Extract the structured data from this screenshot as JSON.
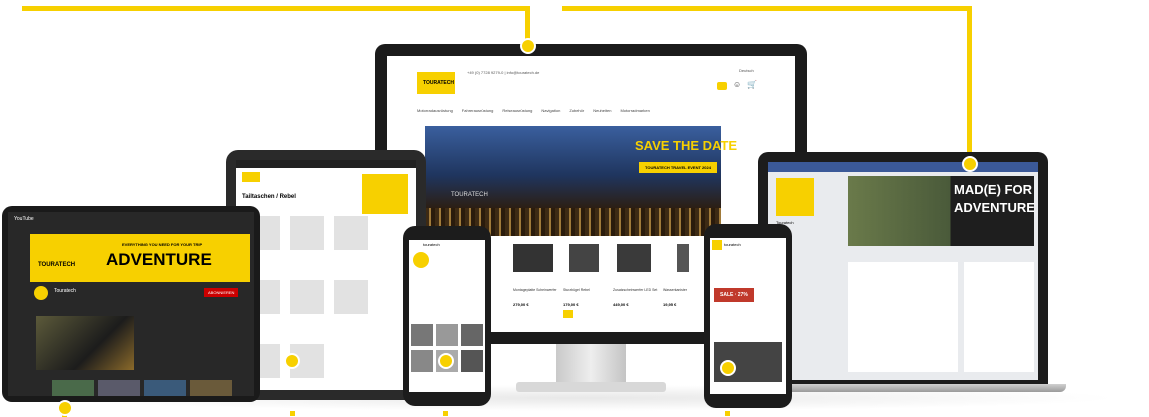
{
  "brand": {
    "name": "TOURATECH",
    "accent": "#f7d000",
    "dark": "#1e1e1e"
  },
  "youtube": {
    "logo": "YouTube",
    "banner_tag": "EVERYTHING YOU NEED FOR YOUR TRIP",
    "banner_brand": "TOURATECH",
    "banner_word": "ADVENTURE",
    "channel": "Touratech",
    "subscribe": "ABONNIEREN"
  },
  "tablet": {
    "heading": "Tailtaschen / Rebel"
  },
  "desktop": {
    "phone": "+49 (0) 7728 9279-0 | info@touratech.de",
    "lang": "Deutsch",
    "nav": [
      "Motorradausrüstung",
      "Fahrerausrüstung",
      "Reiseausrüstung",
      "Navigation",
      "Zubehör",
      "Neuheiten",
      "Motorradmarken"
    ],
    "hero_title": "SAVE THE DATE",
    "hero_button": "TOURATECH TRAVEL EVENT 2024",
    "hero_logo": "TOURATECH",
    "products": [
      {
        "name": "Montageplatte Scheinwerfer",
        "price": "279,00 €"
      },
      {
        "name": "Sturzbügel Rebel",
        "price": "179,00 €"
      },
      {
        "name": "Zusatzscheinwerfer LED Set",
        "price": "449,00 €"
      },
      {
        "name": "Wasserkanister",
        "price": "19,95 €"
      }
    ]
  },
  "laptop": {
    "cover_line1": "MAD(E) FOR",
    "cover_line2": "ADVENTURE",
    "page_name": "Touratech"
  },
  "instagram_phone": {
    "name": "touratech"
  },
  "fb_phone": {
    "name": "touratech",
    "sale": "SALE · 27%"
  }
}
